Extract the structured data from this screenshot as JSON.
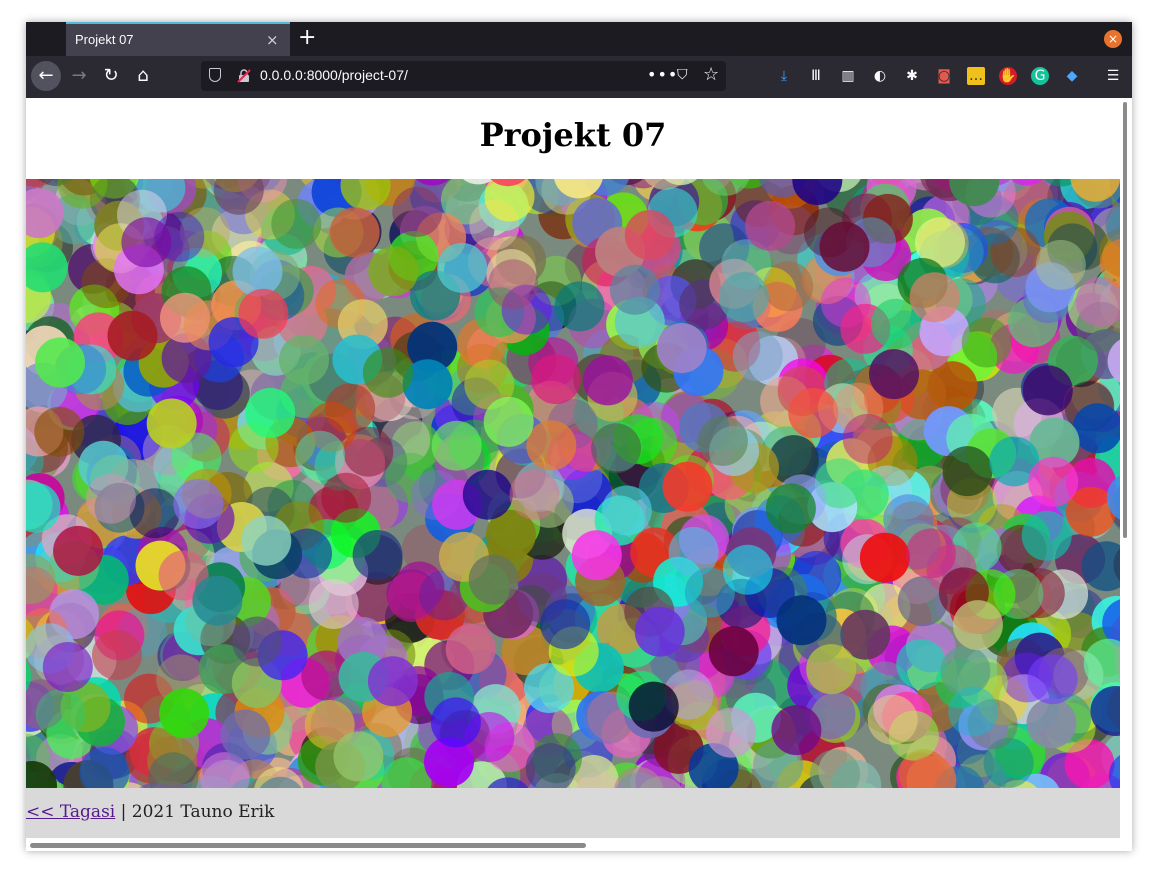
{
  "browser": {
    "tab_title": "Projekt 07",
    "tab_close": "×",
    "new_tab": "+",
    "window_close": "×",
    "url": "0.0.0.0:8000/project-07/",
    "url_more": "•••",
    "toolbar_icons": [
      "download-icon",
      "library-icon",
      "sidebar-icon",
      "privacy-badger-icon",
      "github-icon",
      "screenshot-icon",
      "sticky-note-icon",
      "ublock-icon",
      "grammarly-icon",
      "gem-icon",
      "menu-icon"
    ]
  },
  "page": {
    "title": "Projekt 07",
    "footer_link": "<< Tagasi",
    "footer_text": " | 2021 Tauno Erik"
  }
}
